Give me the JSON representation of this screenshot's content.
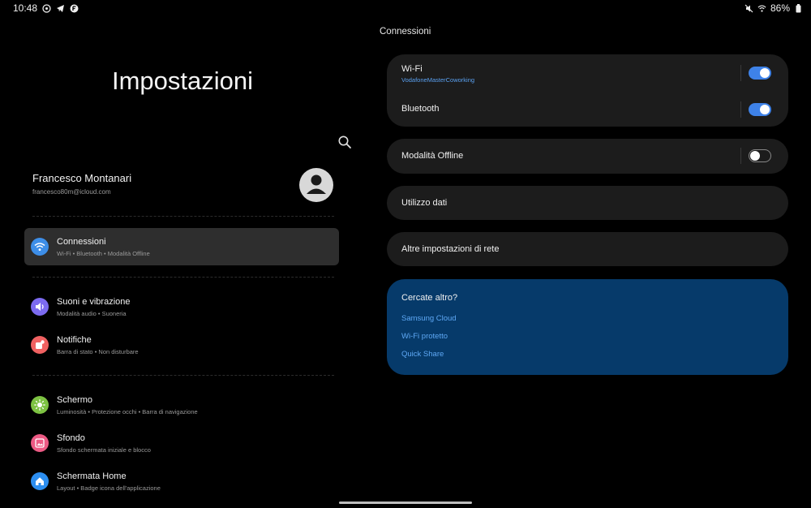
{
  "status_bar": {
    "time": "10:48",
    "battery": "86%"
  },
  "left_pane": {
    "title": "Impostazioni",
    "profile": {
      "name": "Francesco Montanari",
      "email": "francesco80m@icloud.com"
    },
    "items": [
      {
        "label": "Connessioni",
        "sub": "Wi-Fi  •  Bluetooth  •  Modalità Offline",
        "icon": "wifi-icon",
        "color": "#3d8ee8",
        "selected": true
      },
      {
        "label": "Suoni e vibrazione",
        "sub": "Modalità audio  •  Suoneria",
        "icon": "speaker-icon",
        "color": "#7c6bf0"
      },
      {
        "label": "Notifiche",
        "sub": "Barra di stato  •  Non disturbare",
        "icon": "notification-icon",
        "color": "#f06161"
      },
      {
        "label": "Schermo",
        "sub": "Luminosità  •  Protezione occhi  •  Barra di navigazione",
        "icon": "brightness-icon",
        "color": "#7dc242"
      },
      {
        "label": "Sfondo",
        "sub": "Sfondo schermata iniziale e blocco",
        "icon": "wallpaper-icon",
        "color": "#ec5a84"
      },
      {
        "label": "Schermata Home",
        "sub": "Layout  •  Badge icona dell'applicazione",
        "icon": "home-icon",
        "color": "#2c8ef0"
      }
    ]
  },
  "right_pane": {
    "title": "Connessioni",
    "wifi": {
      "label": "Wi-Fi",
      "network": "VodafoneMasterCoworking",
      "enabled": true
    },
    "bluetooth": {
      "label": "Bluetooth",
      "enabled": true
    },
    "offline": {
      "label": "Modalità Offline",
      "enabled": false
    },
    "data_usage": {
      "label": "Utilizzo dati"
    },
    "other_network": {
      "label": "Altre impostazioni di rete"
    },
    "more": {
      "title": "Cercate altro?",
      "links": [
        "Samsung Cloud",
        "Wi-Fi protetto",
        "Quick Share"
      ]
    }
  },
  "colors": {
    "accent": "#3e82e8",
    "link": "#5ea8f5",
    "more_card": "#063a6a"
  }
}
